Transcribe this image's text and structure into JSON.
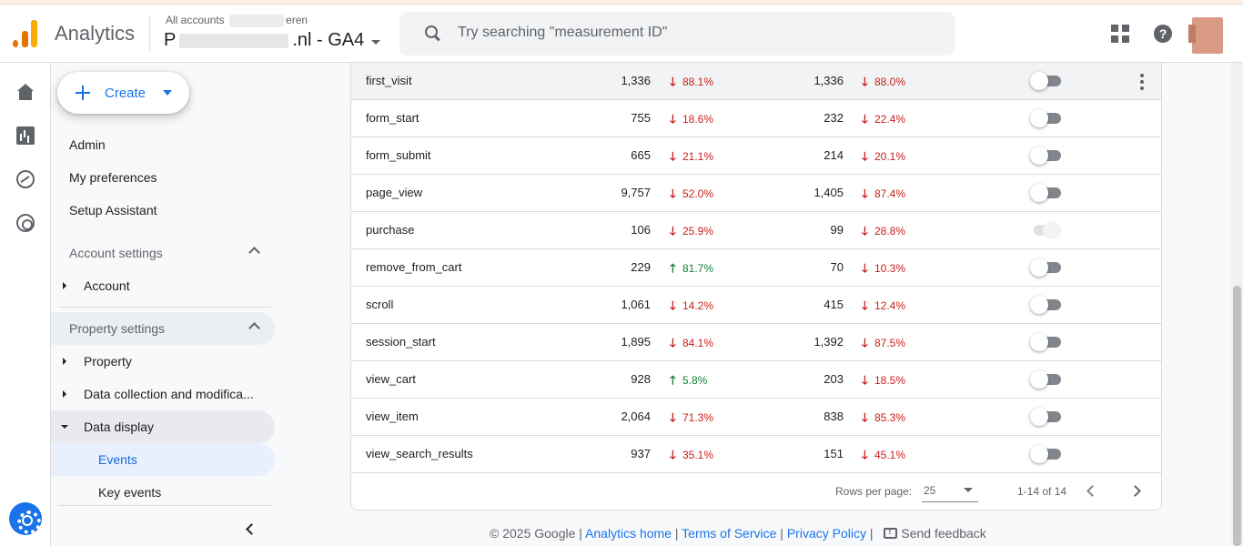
{
  "header": {
    "app_name": "Analytics",
    "account_crumb": "All accounts",
    "account_crumb_suffix": "eren",
    "property_prefix": "P",
    "property_suffix": ".nl - GA4",
    "search_placeholder": "Try searching \"measurement ID\"",
    "help_glyph": "?"
  },
  "nav": {
    "create_label": "Create",
    "admin": "Admin",
    "my_preferences": "My preferences",
    "setup_assistant": "Setup Assistant",
    "account_settings": "Account settings",
    "account": "Account",
    "property_settings": "Property settings",
    "property": "Property",
    "data_collection": "Data collection and modifica...",
    "data_display": "Data display",
    "events": "Events",
    "key_events": "Key events"
  },
  "table": {
    "rows": [
      {
        "name": "first_visit",
        "count": "1,336",
        "count_change": "88.1%",
        "count_dir": "down",
        "users": "1,336",
        "users_change": "88.0%",
        "users_dir": "down",
        "key_event": false
      },
      {
        "name": "form_start",
        "count": "755",
        "count_change": "18.6%",
        "count_dir": "down",
        "users": "232",
        "users_change": "22.4%",
        "users_dir": "down",
        "key_event": false
      },
      {
        "name": "form_submit",
        "count": "665",
        "count_change": "21.1%",
        "count_dir": "down",
        "users": "214",
        "users_change": "20.1%",
        "users_dir": "down",
        "key_event": false
      },
      {
        "name": "page_view",
        "count": "9,757",
        "count_change": "52.0%",
        "count_dir": "down",
        "users": "1,405",
        "users_change": "87.4%",
        "users_dir": "down",
        "key_event": false
      },
      {
        "name": "purchase",
        "count": "106",
        "count_change": "25.9%",
        "count_dir": "down",
        "users": "99",
        "users_change": "28.8%",
        "users_dir": "down",
        "key_event": true
      },
      {
        "name": "remove_from_cart",
        "count": "229",
        "count_change": "81.7%",
        "count_dir": "up",
        "users": "70",
        "users_change": "10.3%",
        "users_dir": "down",
        "key_event": false
      },
      {
        "name": "scroll",
        "count": "1,061",
        "count_change": "14.2%",
        "count_dir": "down",
        "users": "415",
        "users_change": "12.4%",
        "users_dir": "down",
        "key_event": false
      },
      {
        "name": "session_start",
        "count": "1,895",
        "count_change": "84.1%",
        "count_dir": "down",
        "users": "1,392",
        "users_change": "87.5%",
        "users_dir": "down",
        "key_event": false
      },
      {
        "name": "view_cart",
        "count": "928",
        "count_change": "5.8%",
        "count_dir": "up",
        "users": "203",
        "users_change": "18.5%",
        "users_dir": "down",
        "key_event": false
      },
      {
        "name": "view_item",
        "count": "2,064",
        "count_change": "71.3%",
        "count_dir": "down",
        "users": "838",
        "users_change": "85.3%",
        "users_dir": "down",
        "key_event": false
      },
      {
        "name": "view_search_results",
        "count": "937",
        "count_change": "35.1%",
        "count_dir": "down",
        "users": "151",
        "users_change": "45.1%",
        "users_dir": "down",
        "key_event": false
      }
    ],
    "rows_per_page_label": "Rows per page:",
    "rows_per_page_value": "25",
    "range_label": "1-14 of 14"
  },
  "footer": {
    "copyright": "© 2025 Google",
    "separator": " | ",
    "analytics_home": "Analytics home",
    "terms": "Terms of Service",
    "privacy": "Privacy Policy",
    "send_feedback": "Send feedback"
  },
  "colors": {
    "accent": "#1a73e8",
    "negative": "#c5221f",
    "positive": "#188038",
    "logo_orange": "#e37400",
    "logo_yellow": "#f9ab00"
  },
  "icons": {
    "up_arrow": "🡑",
    "down_arrow": "🡓",
    "search": "search-icon",
    "apps": "apps-grid-icon",
    "help": "help-icon",
    "settings": "gear-icon"
  }
}
